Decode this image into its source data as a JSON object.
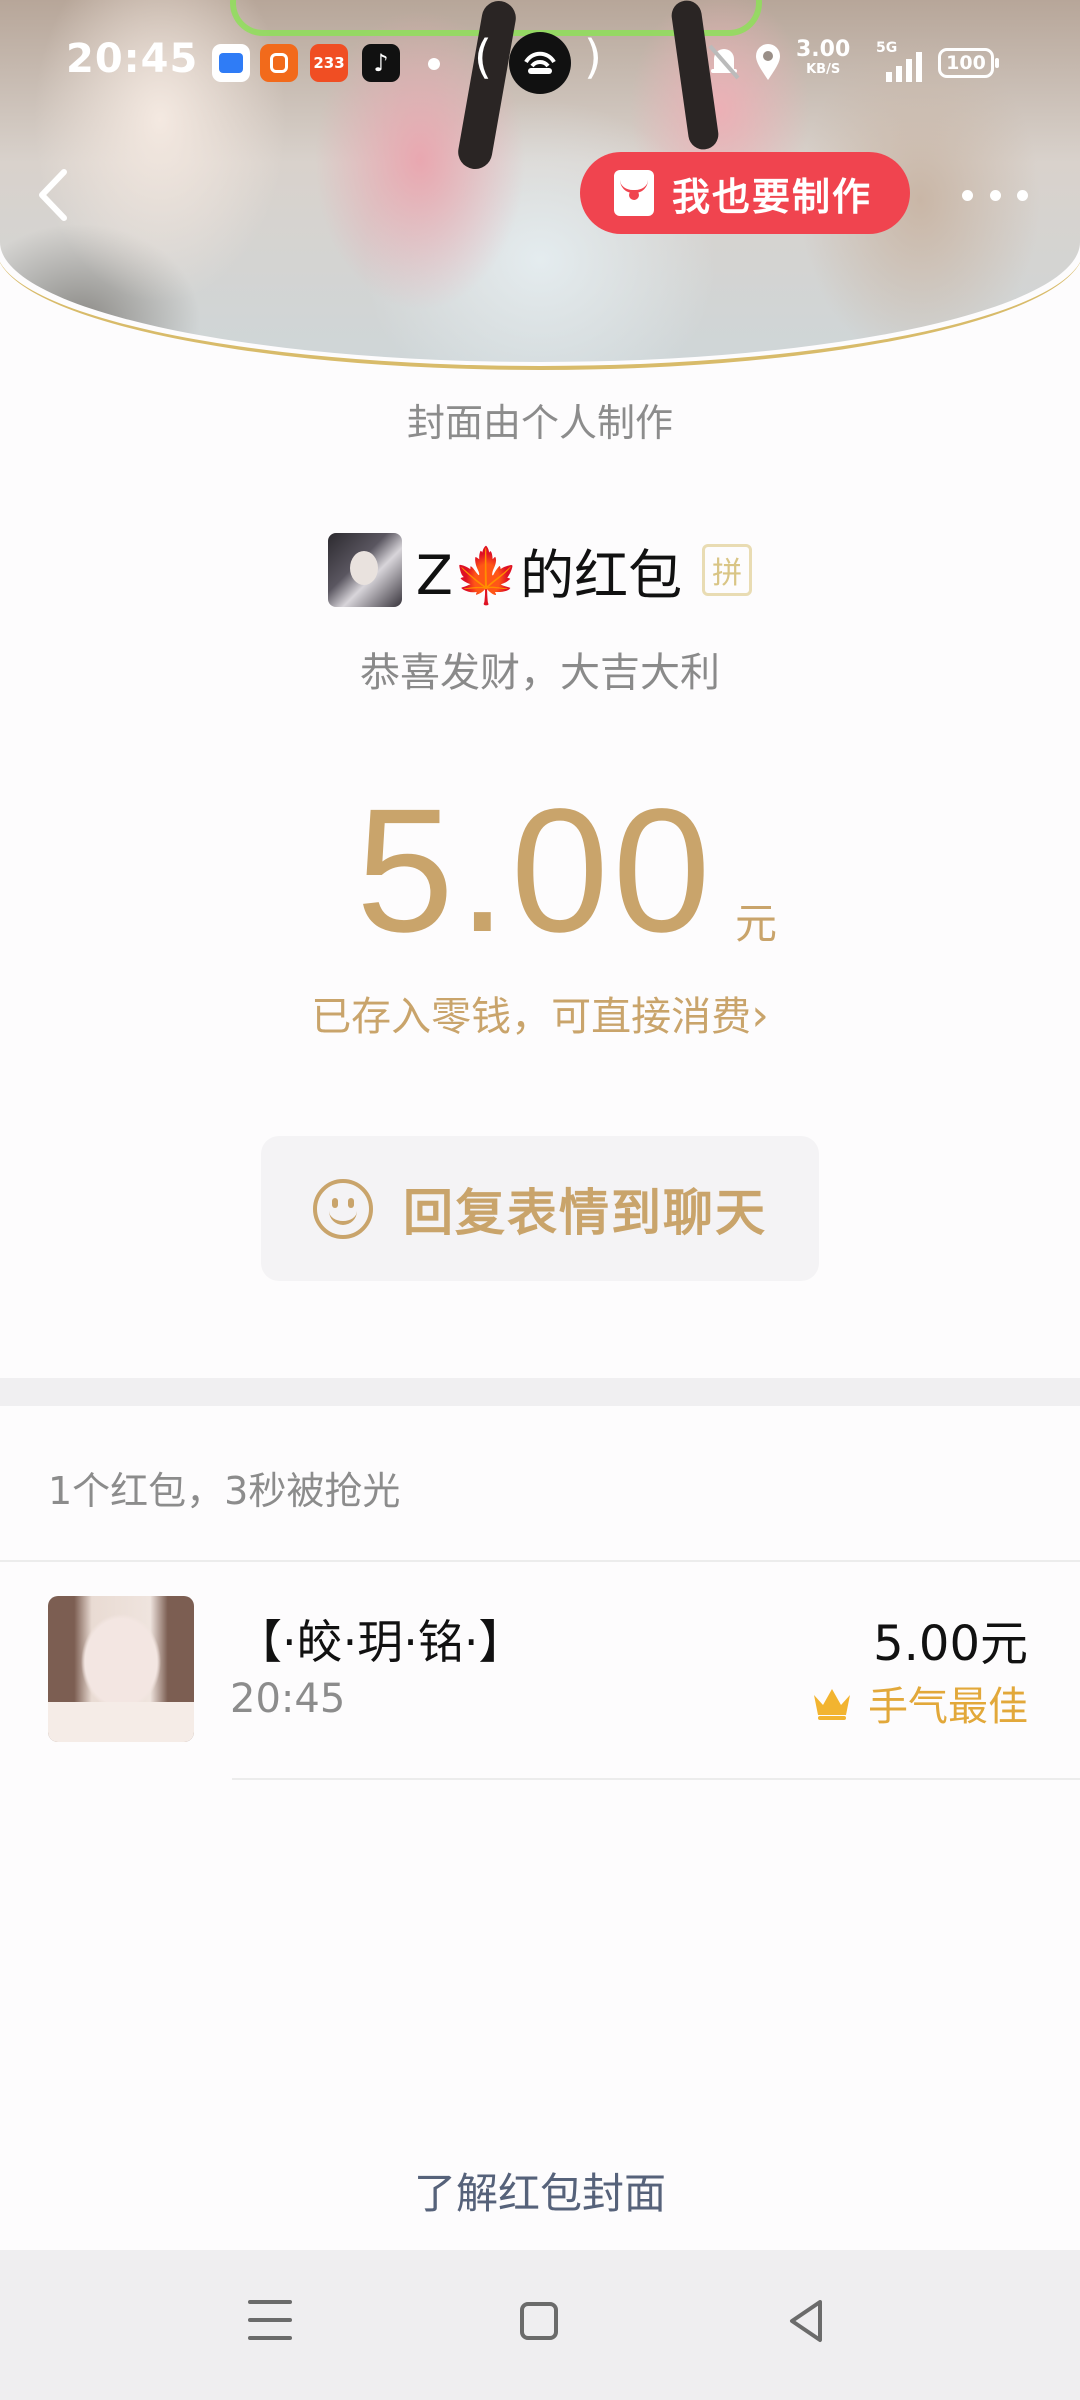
{
  "status_bar": {
    "time": "20:45",
    "app_icons": [
      {
        "name": "blue-app-icon",
        "color": "#2f7cf6",
        "text": ""
      },
      {
        "name": "orange-app-icon",
        "color": "#f26a1b",
        "text": ""
      },
      {
        "name": "game-233-icon",
        "color": "#f04e23",
        "text": "233"
      },
      {
        "name": "tiktok-icon",
        "color": "#111111",
        "text": ""
      }
    ],
    "network_speed": "3.00",
    "network_speed_unit": "KB/S",
    "network_type": "5G",
    "battery": "100"
  },
  "header": {
    "make_button_label": "我也要制作"
  },
  "cover_note": "封面由个人制作",
  "sender": {
    "name": "Z🍁的红包",
    "tag": "拼"
  },
  "blessing": "恭喜发财，大吉大利",
  "amount": {
    "value": "5.00",
    "unit": "元",
    "stored_link": "已存入零钱，可直接消费",
    "link_chevron": "›"
  },
  "reply_button_label": "回复表情到聊天",
  "summary": "1个红包，3秒被抢光",
  "records": [
    {
      "name": "【·皎·玥·铭·】",
      "time": "20:45",
      "amount": "5.00元",
      "badge": "手气最佳"
    }
  ],
  "learn_link": "了解红包封面",
  "colors": {
    "accent_gold": "#c9a46b",
    "make_button_red": "#f0444f",
    "best_luck_orange": "#e2a83a"
  }
}
